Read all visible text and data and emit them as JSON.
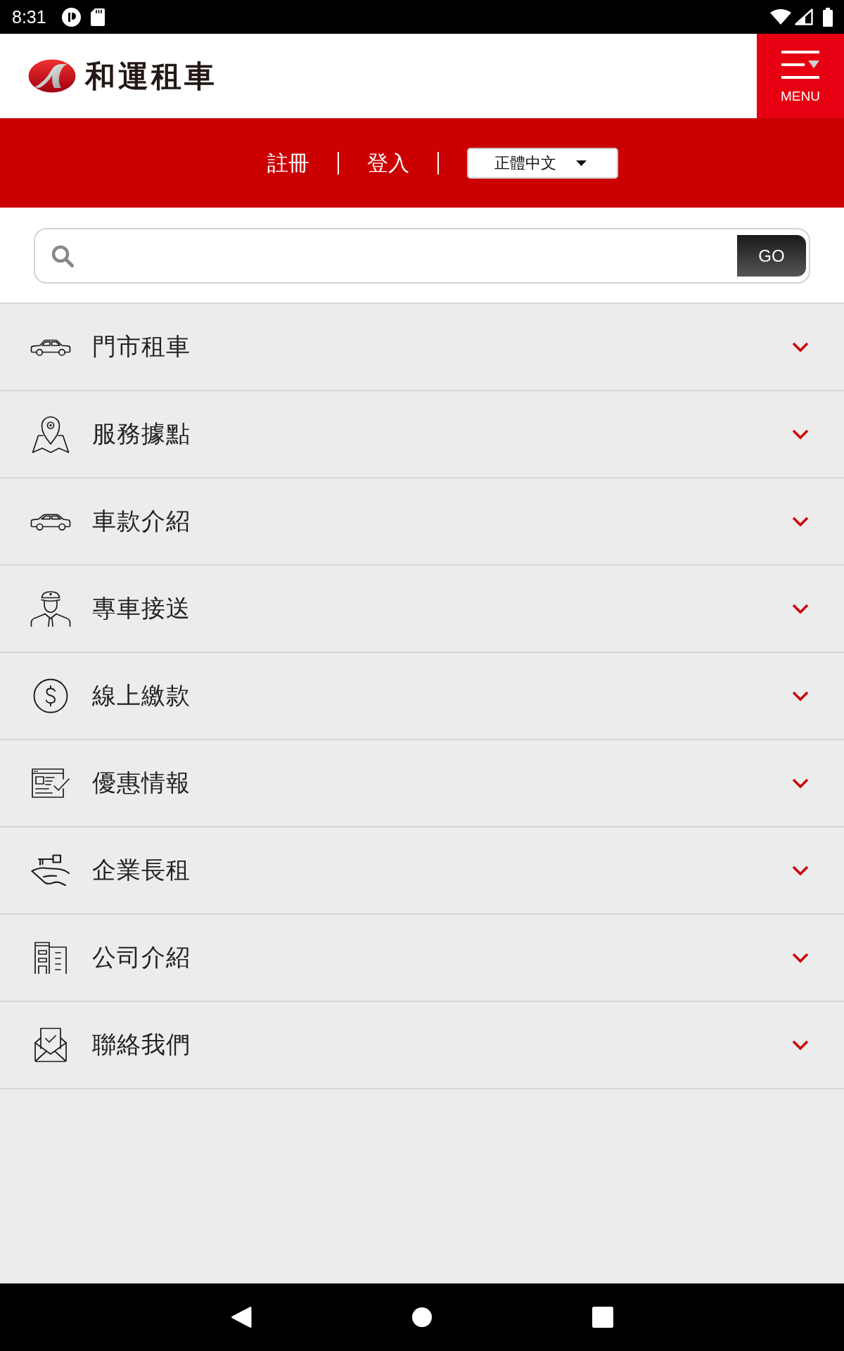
{
  "status_bar": {
    "time": "8:31"
  },
  "header": {
    "logo_text": "和運租車",
    "menu_label": "MENU"
  },
  "account_bar": {
    "links": [
      "註冊",
      "登入"
    ],
    "language": "正體中文"
  },
  "search": {
    "button": "GO"
  },
  "menu_items": [
    {
      "label": "門市租車",
      "expanded": false
    },
    {
      "label": "服務據點",
      "expanded": false
    },
    {
      "label": "車款介紹",
      "expanded": false
    },
    {
      "label": "專車接送",
      "expanded": false
    },
    {
      "label": "線上繳款",
      "expanded": false
    },
    {
      "label": "優惠情報",
      "expanded": false
    },
    {
      "label": "企業長租",
      "expanded": false
    },
    {
      "label": "公司介紹",
      "expanded": false
    },
    {
      "label": "聯絡我們",
      "expanded": false
    }
  ]
}
